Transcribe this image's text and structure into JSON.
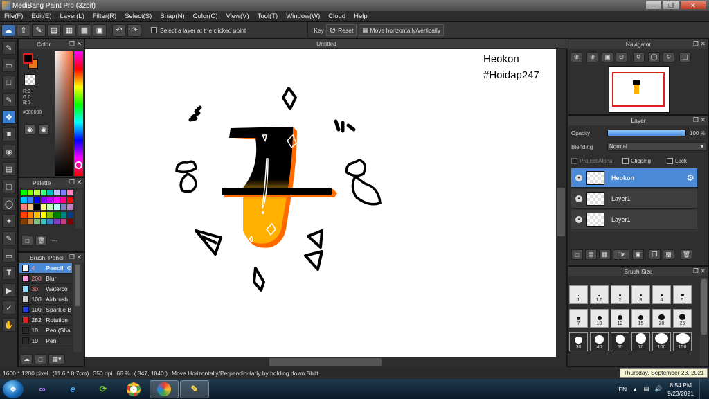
{
  "window": {
    "title": "MediBang Paint Pro (32bit)"
  },
  "menu": [
    "File(F)",
    "Edit(E)",
    "Layer(L)",
    "Filter(R)",
    "Select(S)",
    "Snap(N)",
    "Color(C)",
    "View(V)",
    "Tool(T)",
    "Window(W)",
    "Cloud",
    "Help"
  ],
  "toolbar": {
    "select_layer_label": "Select a layer at the clicked point",
    "key_label": "Key",
    "reset_label": "Reset",
    "move_label": "Move horizontally/vertically"
  },
  "color_panel": {
    "title": "Color",
    "r": "R:0",
    "g": "G:0",
    "b": "B:0",
    "hex": "#000000",
    "primary_color": "#000000",
    "secondary_color": "#f07a1a"
  },
  "palette_panel": {
    "title": "Palette",
    "page_label": "---",
    "colors": [
      "#00ff00",
      "#80ff00",
      "#c0ff40",
      "#40ff80",
      "#00c0c0",
      "#c0c0ff",
      "#8080ff",
      "#ff80c0",
      "#00c0ff",
      "#4080ff",
      "#0000ff",
      "#8000ff",
      "#c000ff",
      "#ff00ff",
      "#ff0080",
      "#ff0000",
      "#ff8080",
      "#ffc080",
      "#000000",
      "#ffff80",
      "#c0ffc0",
      "#c0ffff",
      "#8080c0",
      "#c080c0",
      "#ff4000",
      "#ff8000",
      "#ffc000",
      "#ffff00",
      "#80c000",
      "#008000",
      "#008080",
      "#004080",
      "#804000",
      "#c08040",
      "#80c080",
      "#40c0c0",
      "#4080c0",
      "#8040c0",
      "#c04080",
      "#800000"
    ]
  },
  "brush_panel": {
    "title": "Brush: Pencil",
    "items": [
      {
        "size": "4",
        "name": "Pencil",
        "color": "#ffffff"
      },
      {
        "size": "200",
        "name": "Blur",
        "color": "#ff9be0"
      },
      {
        "size": "30",
        "name": "Waterco",
        "color": "#8fe0ff"
      },
      {
        "size": "100",
        "name": "Airbrush",
        "color": "#d0d0d0"
      },
      {
        "size": "100",
        "name": "Sparkle B",
        "color": "#2040e0"
      },
      {
        "size": "282",
        "name": "Rotation",
        "color": "#e02020"
      },
      {
        "size": "10",
        "name": "Pen (Sha",
        "color": "#2a2a2a"
      },
      {
        "size": "10",
        "name": "Pen",
        "color": "#2a2a2a"
      }
    ]
  },
  "canvas": {
    "tab_title": "Untitled",
    "text_line1": "Heokon",
    "text_line2": "#Hoidap247"
  },
  "navigator_panel": {
    "title": "Navigator"
  },
  "layer_panel": {
    "title": "Layer",
    "opacity_label": "Opacity",
    "opacity_value": "100 %",
    "opacity_fraction": 1.0,
    "blending_label": "Blending",
    "blending_value": "Normal",
    "protect_alpha_label": "Protect Alpha",
    "clipping_label": "Clipping",
    "lock_label": "Lock",
    "layers": [
      {
        "name": "Heokon",
        "selected": true
      },
      {
        "name": "Layer1",
        "selected": false
      },
      {
        "name": "Layer1",
        "selected": false
      }
    ]
  },
  "brush_size_panel": {
    "title": "Brush Size",
    "sizes": [
      "1",
      "1.5",
      "2",
      "3",
      "4",
      "5",
      "7",
      "10",
      "12",
      "15",
      "20",
      "25",
      "30",
      "40",
      "50",
      "70",
      "100",
      "150"
    ]
  },
  "status": {
    "canvas_size": "1600 * 1200 pixel",
    "physical_size": "(11.6 * 8.7cm)",
    "dpi": "350 dpi",
    "zoom": "66 %",
    "cursor": "( 347, 1040 )",
    "hint": "Move Horizontally/Perpendicularly by holding down Shift",
    "date_tooltip": "Thursday, September 23, 2021"
  },
  "taskbar": {
    "language": "EN",
    "time": "8:54 PM",
    "date": "9/23/2021"
  }
}
